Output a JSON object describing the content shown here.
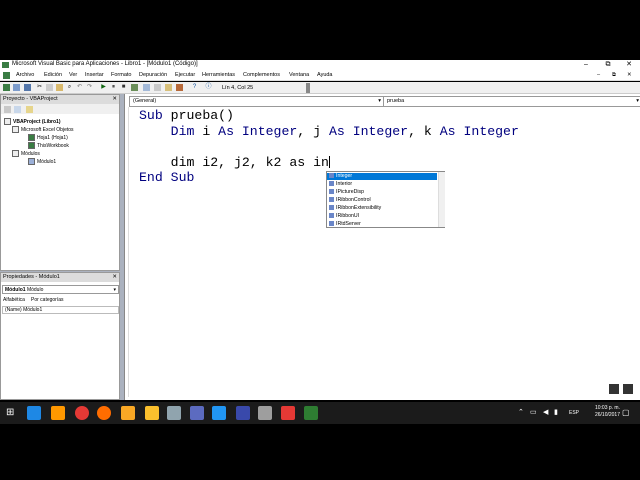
{
  "window": {
    "title": "Microsoft Visual Basic para Aplicaciones - Libro1 - [Módulo1 (Código)]",
    "controls": [
      "–",
      "⧉",
      "✕"
    ]
  },
  "menu": [
    "Archivo",
    "Edición",
    "Ver",
    "Insertar",
    "Formato",
    "Depuración",
    "Ejecutar",
    "Herramientas",
    "Complementos",
    "Ventana",
    "Ayuda"
  ],
  "toolbar": {
    "position": "Lín 4, Col 25"
  },
  "project": {
    "title": "Proyecto - VBAProject",
    "root": "VBAProject (Libro1)",
    "excel_objects": "Microsoft Excel Objetos",
    "sheet": "Hoja1 (Hoja1)",
    "workbook": "ThisWorkbook",
    "modules": "Módulos",
    "module1": "Módulo1"
  },
  "properties": {
    "title": "Propiedades - Módulo1",
    "object": "Módulo1",
    "object_type": "Módulo",
    "tab_alpha": "Alfabética",
    "tab_cat": "Por categorías",
    "row_name": "(Name)",
    "row_value": "Módulo1"
  },
  "editor": {
    "object_combo": "(General)",
    "proc_combo": "prueba",
    "line1_kw": "Sub",
    "line1_rest": " prueba()",
    "line2_kw1": "Dim",
    "line2_mid1": " i ",
    "line2_as1": "As",
    "line2_t1": " Integer",
    "line2_mid2": ", j ",
    "line2_as2": "As",
    "line2_t2": " Integer",
    "line2_mid3": ", k ",
    "line2_as3": "As",
    "line2_t3": " Integer",
    "line4_kw": "dim",
    "line4_rest": " i2, j2, k2 as in",
    "line5_kw": "End Sub"
  },
  "autocomplete": [
    "Integer",
    "Interior",
    "IPictureDisp",
    "IRibbonControl",
    "IRibbonExtensibility",
    "IRibbonUI",
    "IRtdServer"
  ],
  "clock": {
    "time": "10:03 p. m.",
    "date": "26/10/2017",
    "lang": "ESP"
  }
}
